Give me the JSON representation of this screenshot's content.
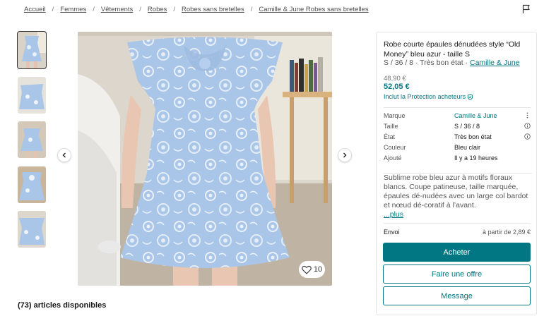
{
  "breadcrumb": [
    "Accueil",
    "Femmes",
    "Vêtements",
    "Robes",
    "Robes sans bretelles",
    "Camille & June Robes sans bretelles"
  ],
  "gallery": {
    "favorites_count": "10",
    "thumbnail_count": 5
  },
  "available_text": "(73) articles disponibles",
  "item": {
    "title": "Robe courte épaules dénudées style “Old Money” bleu azur - taille S",
    "subline_prefix": "S / 36 / 8 · Très bon état · ",
    "subline_brand": "Camille & June",
    "old_price": "48,90 €",
    "price": "52,05 €",
    "protection": "Inclut la Protection acheteurs"
  },
  "details": [
    {
      "label": "Marque",
      "value": "Camille & June"
    },
    {
      "label": "Taille",
      "value": "S / 36 / 8"
    },
    {
      "label": "État",
      "value": "Très bon état"
    },
    {
      "label": "Couleur",
      "value": "Bleu clair"
    },
    {
      "label": "Ajouté",
      "value": "Il y a 19 heures"
    }
  ],
  "description": {
    "text": "Sublime robe bleu azur à motifs floraux blancs. Coupe patineuse, taille marquée, épaules dé-nudées avec un large col bardot et nœud dé-coratif à l’avant.",
    "more": "...plus"
  },
  "shipping": {
    "label": "Envoi",
    "value": "à partir de 2,89 €"
  },
  "buttons": {
    "buy": "Acheter",
    "offer": "Faire une offre",
    "message": "Message"
  },
  "colors": {
    "accent": "#007782",
    "dress": "#a9c6e8"
  },
  "icons": {
    "report": "flag-icon",
    "favorite": "heart-icon",
    "prev": "chevron-left-icon",
    "next": "chevron-right-icon"
  }
}
